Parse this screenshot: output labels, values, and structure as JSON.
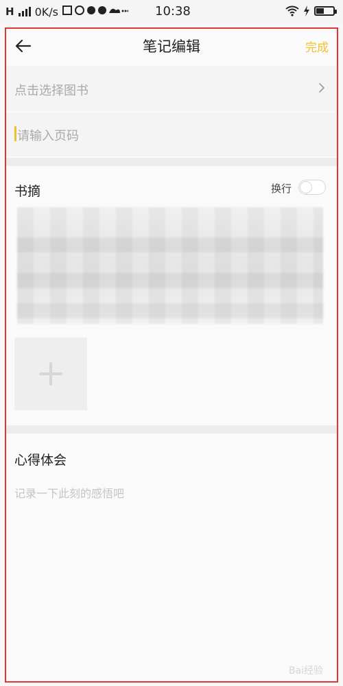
{
  "status_bar": {
    "network": "H",
    "speed": "0K/s",
    "clock": "10:38",
    "battery_level": 0.45
  },
  "nav": {
    "title": "笔记编辑",
    "done_label": "完成"
  },
  "form": {
    "book_label": "点击选择图书",
    "page_placeholder": "请输入页码"
  },
  "excerpt": {
    "title": "书摘",
    "wrap_label": "换行",
    "wrap_on": false
  },
  "thoughts": {
    "title": "心得体会",
    "placeholder": "记录一下此刻的感悟吧"
  },
  "watermark": {
    "text": "Bai经验"
  },
  "colors": {
    "accent": "#f2c12e",
    "frame": "#e03535"
  },
  "icons": {
    "back": "arrow-left",
    "chevron": "chevron-right",
    "add": "plus"
  }
}
